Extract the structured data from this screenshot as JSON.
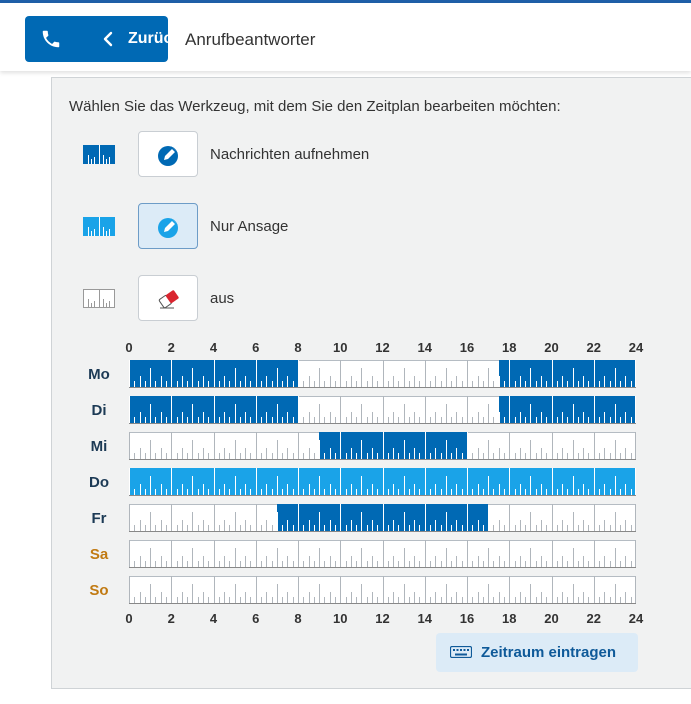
{
  "header": {
    "back_label": "Zurück",
    "title": "Anrufbeantworter"
  },
  "instructions": "Wählen Sie das Werkzeug, mit dem Sie den Zeitplan bearbeiten möchten:",
  "tools": [
    {
      "id": "record",
      "label": "Nachrichten aufnehmen",
      "icon": "pencil-icon",
      "color": "#0069b4",
      "active": false
    },
    {
      "id": "announce",
      "label": "Nur Ansage",
      "icon": "pencil-icon",
      "color": "#1aa3e8",
      "active": true
    },
    {
      "id": "off",
      "label": "aus",
      "icon": "eraser-icon",
      "color": "#ffffff",
      "active": false
    }
  ],
  "hour_labels": [
    "0",
    "2",
    "4",
    "6",
    "8",
    "10",
    "12",
    "14",
    "16",
    "18",
    "20",
    "22",
    "24"
  ],
  "schedule": [
    {
      "day": "Mo",
      "weekend": false,
      "segments": [
        {
          "from": 0,
          "to": 8,
          "tool": "record"
        },
        {
          "from": 17.5,
          "to": 24,
          "tool": "record"
        }
      ]
    },
    {
      "day": "Di",
      "weekend": false,
      "segments": [
        {
          "from": 0,
          "to": 8,
          "tool": "record"
        },
        {
          "from": 17.5,
          "to": 24,
          "tool": "record"
        }
      ]
    },
    {
      "day": "Mi",
      "weekend": false,
      "segments": [
        {
          "from": 9,
          "to": 16,
          "tool": "record"
        }
      ]
    },
    {
      "day": "Do",
      "weekend": false,
      "segments": [
        {
          "from": 0,
          "to": 24,
          "tool": "announce"
        }
      ]
    },
    {
      "day": "Fr",
      "weekend": false,
      "segments": [
        {
          "from": 7,
          "to": 17,
          "tool": "record"
        }
      ]
    },
    {
      "day": "Sa",
      "weekend": true,
      "segments": []
    },
    {
      "day": "So",
      "weekend": true,
      "segments": []
    }
  ],
  "colors": {
    "record": "#0069b4",
    "announce": "#1aa3e8",
    "weekend_label": "#c17a12"
  },
  "enter_period_label": "Zeitraum eintragen"
}
